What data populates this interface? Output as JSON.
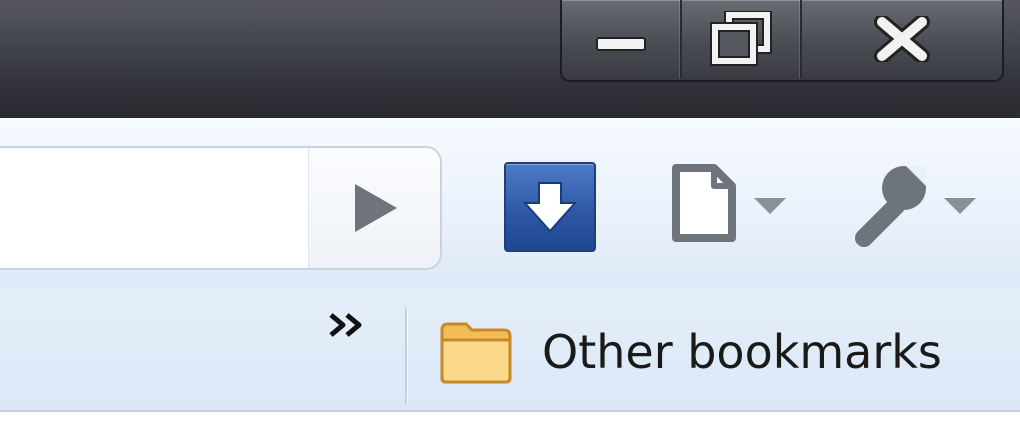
{
  "window": {
    "controls": {
      "minimize_icon": "minimize-icon",
      "maximize_icon": "restore-icon",
      "close_icon": "close-icon"
    }
  },
  "toolbar": {
    "address_value": "",
    "go_icon": "play-triangle-icon",
    "download_icon": "download-arrow-icon",
    "page_menu_icon": "page-icon",
    "wrench_menu_icon": "wrench-icon",
    "colors": {
      "download_button": "#2c56a4",
      "icon_gray": "#6e747c"
    }
  },
  "bookmarks_bar": {
    "overflow_label": "»",
    "other_bookmarks_label": "Other bookmarks",
    "folder_icon": "folder-icon",
    "colors": {
      "folder": "#f7c96b"
    }
  }
}
